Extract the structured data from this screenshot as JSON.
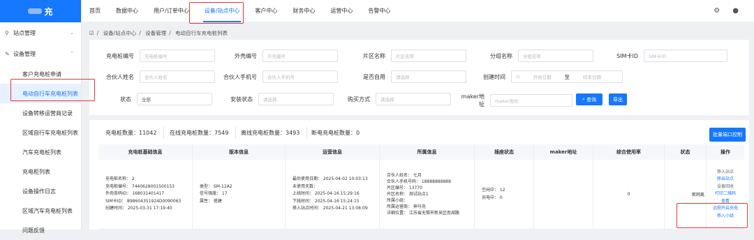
{
  "app": {
    "logo_text": "充"
  },
  "sidebar": {
    "groups": [
      {
        "label": "站点管理",
        "icon": "tag-icon"
      },
      {
        "label": "设备管理",
        "icon": "edit-icon"
      }
    ],
    "items": [
      {
        "label": "客户充电桩申请"
      },
      {
        "label": "电动自行车充电桩列表"
      },
      {
        "label": "设备转移运营商记录"
      },
      {
        "label": "区域自行车充电桩列表"
      },
      {
        "label": "汽车充电桩列表"
      },
      {
        "label": "充电柜列表"
      },
      {
        "label": "设备操作日志"
      },
      {
        "label": "区域汽车充电桩列表"
      },
      {
        "label": "问题反馈"
      }
    ]
  },
  "topnav": {
    "menus": [
      "首页",
      "数据中心",
      "用户/订单中心",
      "设备/站点中心",
      "客户中心",
      "财务中心",
      "运营中心",
      "告警中心"
    ],
    "active_index": 3
  },
  "breadcrumb": [
    "设备/站点中心",
    "设备管理",
    "电动自行车充电桩列表"
  ],
  "filters": {
    "row1": [
      {
        "label": "充电桩编号",
        "placeholder": "充电桩编号"
      },
      {
        "label": "外壳编号",
        "placeholder": "外壳编号"
      },
      {
        "label": "片区名称",
        "placeholder": "片区名称"
      },
      {
        "label": "分组名称",
        "placeholder": "分组名称"
      },
      {
        "label": "SIM卡ID",
        "placeholder": "SIM卡ID"
      }
    ],
    "row2": [
      {
        "label": "合伙人姓名",
        "placeholder": "合伙人姓名"
      },
      {
        "label": "合伙人手机号",
        "placeholder": "合伙人手机号"
      },
      {
        "label": "是否自用",
        "placeholder": "请选择"
      },
      {
        "label": "创建时间",
        "start": "开始日期",
        "sep": "至",
        "end": "结束日期"
      }
    ],
    "row3": [
      {
        "label": "状态",
        "value": "全部"
      },
      {
        "label": "安装状态",
        "placeholder": "请选择"
      },
      {
        "label": "购买方式",
        "placeholder": "请选择"
      },
      {
        "label": "maker地址",
        "placeholder": "maker地址"
      }
    ],
    "search_label": "查询",
    "export_label": "导出"
  },
  "stats": [
    "充电桩数量：11042",
    "在线充电桩数量：7549",
    "离线充电桩数量：3493",
    "断电充电桩数量：0"
  ],
  "batch_button": "批量端口控制",
  "table": {
    "headers": [
      "充电桩基础信息",
      "版本信息",
      "运营信息",
      "所属信息",
      "插座状态",
      "maker地址",
      "综合使用率",
      "状态",
      "操作"
    ],
    "row": {
      "basic": [
        "充电桩名称：  2",
        "充电桩编号：  7440628001500153",
        "外壳条码ID：  168031401417",
        "SIM卡ID：  898604351924D0090063",
        "创建时间：  2025-03-31 17:19:40"
      ],
      "version": [
        "类型：  SM-12A2",
        "信号强度：  17",
        "属性：  搭建"
      ],
      "operation": [
        "最后使用日期：  2025-04-02 10:03:13",
        "未使用天数：",
        "上线时间：  2025-04-16 15:29:16",
        "下线时间：  2025-04-16 15:24:15",
        "移入站点时间：  2025-04-21 13:08:09"
      ],
      "owner": [
        "合伙人姓名：  七月",
        "合伙人手机号码：  18888888888",
        "片区编号：  13770",
        "片区名称：  测试站点1",
        "所属小组：",
        "所属运营商：  神马充",
        "详细位置：  江苏省无锡市新吴区南湖路"
      ],
      "socket": [
        "空闲中：  12",
        "充电中：  0"
      ],
      "maker": "",
      "usage": "0",
      "status": "断网离",
      "ops": [
        "移入站点",
        "移出站点",
        "设备回收",
        "打印二维码",
        "查看",
        "远程开启充电",
        "移入小组"
      ]
    }
  }
}
